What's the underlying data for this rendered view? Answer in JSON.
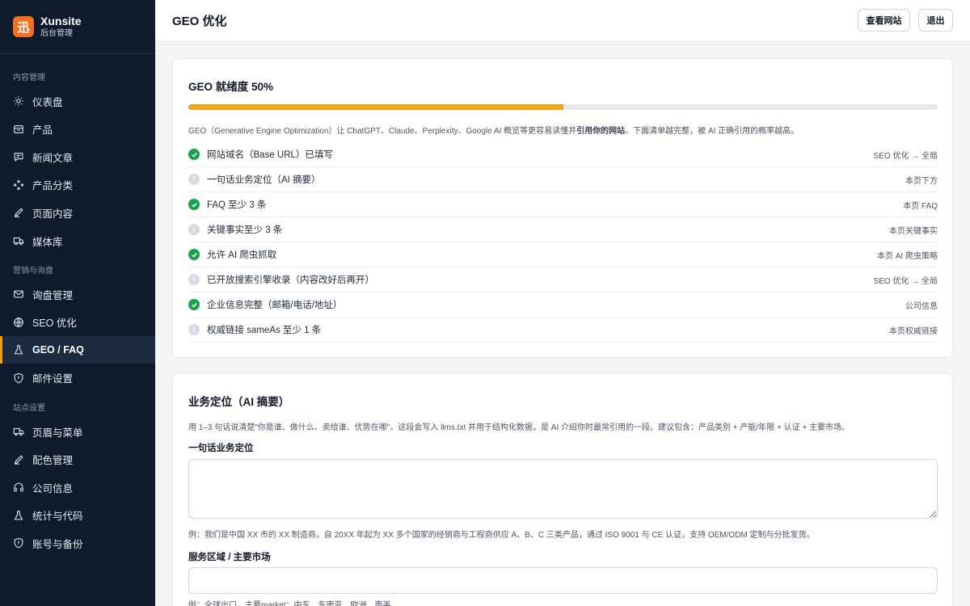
{
  "brand": {
    "logo_char": "迅",
    "name": "Xunsite",
    "subtitle": "后台管理"
  },
  "sidebar": {
    "groups": [
      {
        "title": "内容管理",
        "items": [
          {
            "label": "仪表盘",
            "icon": "sun-icon"
          },
          {
            "label": "产品",
            "icon": "box-icon"
          },
          {
            "label": "新闻文章",
            "icon": "message-icon"
          },
          {
            "label": "产品分类",
            "icon": "category-icon"
          },
          {
            "label": "页面内容",
            "icon": "pen-icon"
          },
          {
            "label": "媒体库",
            "icon": "truck-icon"
          }
        ]
      },
      {
        "title": "营销与询盘",
        "items": [
          {
            "label": "询盘管理",
            "icon": "mail-icon"
          },
          {
            "label": "SEO 优化",
            "icon": "globe-icon"
          },
          {
            "label": "GEO / FAQ",
            "icon": "flask-icon",
            "active": true
          },
          {
            "label": "邮件设置",
            "icon": "shield-icon"
          }
        ]
      },
      {
        "title": "站点设置",
        "items": [
          {
            "label": "页眉与菜单",
            "icon": "truck-icon"
          },
          {
            "label": "配色管理",
            "icon": "pen-icon"
          },
          {
            "label": "公司信息",
            "icon": "headphones-icon"
          },
          {
            "label": "统计与代码",
            "icon": "flask-icon"
          },
          {
            "label": "账号与备份",
            "icon": "shield-icon"
          }
        ]
      }
    ]
  },
  "header": {
    "title": "GEO 优化",
    "view_site": "查看网站",
    "logout": "退出"
  },
  "readiness": {
    "title": "GEO 就绪度 50%",
    "progress": 0.5,
    "progress_color": "#f5a11c",
    "desc_before": "GEO（Generative Engine Optimization）让 ChatGPT、Claude、Perplexity、Google AI 概览等更容易读懂并",
    "desc_bold": "引用你的网站",
    "desc_after": "。下面清单越完整，被 AI 正确引用的概率越高。",
    "items": [
      {
        "label": "网站域名（Base URL）已填写",
        "link": "SEO 优化 → 全局",
        "done": true
      },
      {
        "label": "一句话业务定位（AI 摘要）",
        "link": "本页下方",
        "done": false
      },
      {
        "label": "FAQ 至少 3 条",
        "link": "本页 FAQ",
        "done": true
      },
      {
        "label": "关键事实至少 3 条",
        "link": "本页关键事实",
        "done": false
      },
      {
        "label": "允许 AI 爬虫抓取",
        "link": "本页 AI 爬虫策略",
        "done": true
      },
      {
        "label": "已开放搜索引擎收录（内容改好后再开）",
        "link": "SEO 优化 → 全局",
        "done": false
      },
      {
        "label": "企业信息完整（邮箱/电话/地址）",
        "link": "公司信息",
        "done": true
      },
      {
        "label": "权威链接 sameAs 至少 1 条",
        "link": "本页权威链接",
        "done": false
      }
    ]
  },
  "positioning": {
    "title": "业务定位（AI 摘要）",
    "desc": "用 1–3 句话说清楚\"你是谁、做什么、卖给谁、优势在哪\"。这段会写入 llms.txt 并用于结构化数据，是 AI 介绍你时最常引用的一段。建议包含：产品类别 + 产能/年限 + 认证 + 主要市场。",
    "field1_label": "一句话业务定位",
    "field1_value": "",
    "field1_hint": "例：我们是中国 XX 市的 XX 制造商，自 20XX 年起为 XX 多个国家的经销商与工程商供应 A、B、C 三类产品，通过 ISO 9001 与 CE 认证，支持 OEM/ODM 定制与分批发货。",
    "field2_label": "服务区域 / 主要市场",
    "field2_value": "",
    "field2_hint": "例：全球出口，主要market：中东、东南亚、欧洲、南美"
  }
}
